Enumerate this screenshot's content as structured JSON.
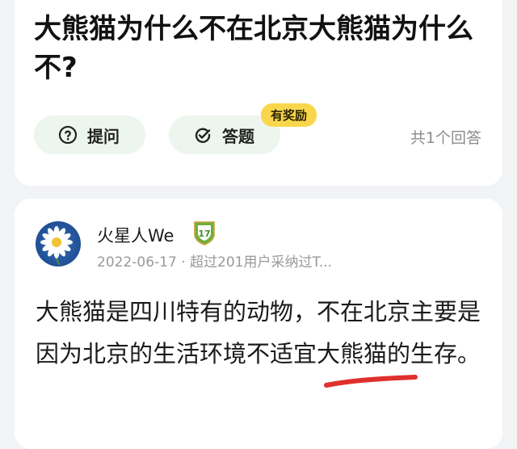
{
  "question": {
    "title": "大熊猫为什么不在北京大熊猫为什么不?",
    "ask_label": "提问",
    "answer_label": "答题",
    "reward_badge": "有奖励",
    "answer_count": "共1个回答"
  },
  "answer": {
    "author_name": "火星人We",
    "level_badge": "17",
    "meta": "2022-06-17 · 超过201用户采纳过T...",
    "content": "大熊猫是四川特有的动物，不在北京主要是因为北京的生活环境不适宜大熊猫的生存。"
  },
  "colors": {
    "pill_bg": "#edf6ee",
    "badge_bg": "#f9d64c",
    "level_badge": "#6fae3c",
    "annotation": "#e0302e"
  },
  "icons": {
    "ask": "question-circle-icon",
    "answer": "pen-check-icon",
    "level": "level-shield-icon"
  }
}
